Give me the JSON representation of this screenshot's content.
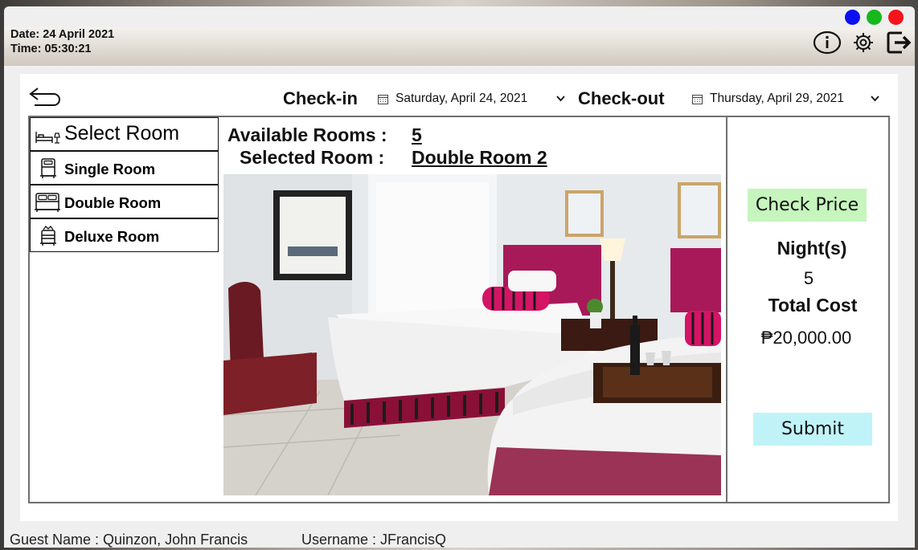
{
  "header": {
    "date": "Date: 24 April 2021",
    "time": "Time: 05:30:21"
  },
  "window_controls": {
    "colors": [
      "#0a10f0",
      "#16b81c",
      "#f5141c"
    ],
    "icons": [
      "info-icon",
      "gear-icon",
      "logout-icon"
    ]
  },
  "booking": {
    "checkin_label": "Check-in",
    "checkin_date": "Saturday, April 24, 2021",
    "checkout_label": "Check-out",
    "checkout_date": "Thursday, April 29, 2021"
  },
  "rooms": {
    "heading": "Select Room",
    "items": [
      {
        "label": "Single Room",
        "icon": "single-bed-icon"
      },
      {
        "label": "Double Room",
        "icon": "double-bed-icon"
      },
      {
        "label": "Deluxe Room",
        "icon": "deluxe-bed-icon"
      }
    ]
  },
  "info": {
    "available_label": "Available Rooms :",
    "available_value": "5",
    "selected_label": "Selected Room :",
    "selected_value": "Double Room 2"
  },
  "summary": {
    "check_price_label": "Check Price",
    "nights_label": "Night(s)",
    "nights_value": "5",
    "total_label": "Total Cost",
    "total_value": "₱20,000.00",
    "submit_label": "Submit",
    "check_price_color": "#c6f5bd",
    "submit_color": "#c0f3f7"
  },
  "footer": {
    "guest": "Guest Name : Quinzon, John Francis",
    "username": "Username : JFrancisQ"
  }
}
